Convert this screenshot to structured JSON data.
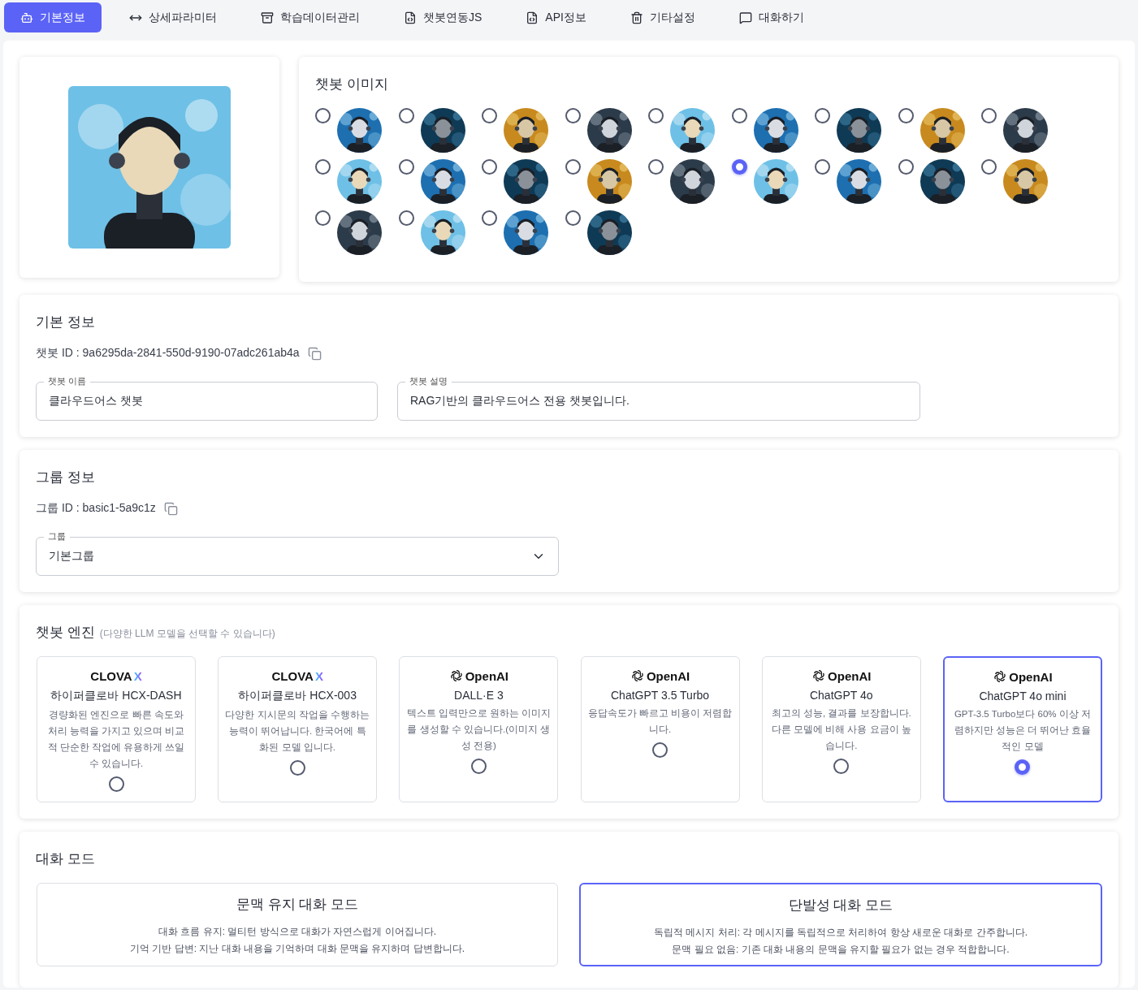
{
  "tabs": [
    {
      "label": "기본정보",
      "selected": true
    },
    {
      "label": "상세파라미터",
      "selected": false
    },
    {
      "label": "학습데이터관리",
      "selected": false
    },
    {
      "label": "챗봇연동JS",
      "selected": false
    },
    {
      "label": "API정보",
      "selected": false
    },
    {
      "label": "기타설정",
      "selected": false
    },
    {
      "label": "대화하기",
      "selected": false
    }
  ],
  "image_picker": {
    "title": "챗봇 이미지",
    "avatars": [
      {
        "selected": false
      },
      {
        "selected": false
      },
      {
        "selected": false
      },
      {
        "selected": false
      },
      {
        "selected": false
      },
      {
        "selected": false
      },
      {
        "selected": false
      },
      {
        "selected": false
      },
      {
        "selected": false
      },
      {
        "selected": false
      },
      {
        "selected": false
      },
      {
        "selected": false
      },
      {
        "selected": false
      },
      {
        "selected": false
      },
      {
        "selected": true
      },
      {
        "selected": false
      },
      {
        "selected": false
      },
      {
        "selected": false
      },
      {
        "selected": false
      },
      {
        "selected": false
      },
      {
        "selected": false
      },
      {
        "selected": false
      }
    ]
  },
  "basic_info": {
    "title": "기본 정보",
    "id_line": "챗봇 ID : 9a6295da-2841-550d-9190-07adc261ab4a",
    "fields": [
      {
        "label": "챗봇 이름",
        "value": "클라우드어스 챗봇"
      },
      {
        "label": "챗봇 설명",
        "value": "RAG기반의 클라우드어스 전용 챗봇입니다."
      }
    ]
  },
  "group_info": {
    "title": "그룹 정보",
    "id_line": "그룹 ID : basic1-5a9c1z",
    "select": {
      "label": "그룹",
      "value": "기본그룹"
    }
  },
  "engine": {
    "title": "챗봇 엔진",
    "hint": "(다양한 LLM 모델을 선택할 수 있습니다)",
    "models": [
      {
        "vendor": {
          "kind": "clova",
          "name": "CLOVA",
          "mark": "X"
        },
        "name": "하이퍼클로바 HCX-DASH",
        "description": "경량화된 엔진으로 빠른 속도와 처리 능력을 가지고 있으며 비교적 단순한 작업에 유용하게 쓰일 수 있습니다.",
        "selected": false
      },
      {
        "vendor": {
          "kind": "clova",
          "name": "CLOVA",
          "mark": "X"
        },
        "name": "하이퍼클로바 HCX-003",
        "description": "다양한 지시문의 작업을 수행하는 능력이 뛰어납니다. 한국어에 특화된 모델 입니다.",
        "selected": false
      },
      {
        "vendor": {
          "kind": "openai",
          "name": "OpenAI"
        },
        "name": "DALL·E 3",
        "description": "텍스트 입력만으로 원하는 이미지를 생성할 수 있습니다.(이미지 생성 전용)",
        "selected": false
      },
      {
        "vendor": {
          "kind": "openai",
          "name": "OpenAI"
        },
        "name": "ChatGPT 3.5 Turbo",
        "description": "응답속도가 빠르고 비용이 저렴합니다.",
        "selected": false
      },
      {
        "vendor": {
          "kind": "openai",
          "name": "OpenAI"
        },
        "name": "ChatGPT 4o",
        "description": "최고의 성능, 결과를 보장합니다. 다른 모델에 비해 사용 요금이 높습니다.",
        "selected": false
      },
      {
        "vendor": {
          "kind": "openai",
          "name": "OpenAI"
        },
        "name": "ChatGPT 4o mini",
        "description": "GPT-3.5 Turbo보다 60% 이상 저렴하지만 성능은 더 뛰어난 효율적인 모델",
        "selected": true
      }
    ]
  },
  "chat_mode": {
    "title": "대화 모드",
    "modes": [
      {
        "name": "문맥 유지 대화 모드",
        "lines": [
          "대화 흐름 유지: 멀티턴 방식으로 대화가 자연스럽게 이어집니다.",
          "기억 기반 답변: 지난 대화 내용을 기억하며 대화 문맥을 유지하며 답변합니다."
        ],
        "selected": false
      },
      {
        "name": "단발성 대화 모드",
        "lines": [
          "독립적 메시지 처리: 각 메시지를 독립적으로 처리하여 항상 새로운 대화로 간주합니다.",
          "문맥 필요 없음: 기존 대화 내용의 문맥을 유지할 필요가 없는 경우 적합합니다."
        ],
        "selected": true
      }
    ]
  }
}
